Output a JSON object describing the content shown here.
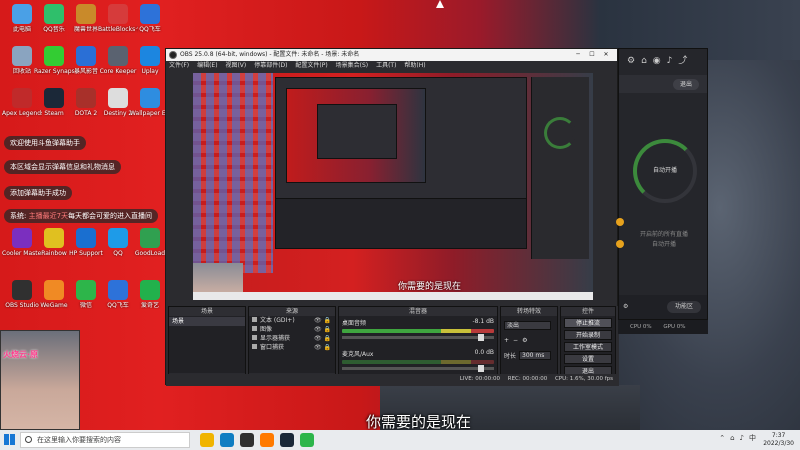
{
  "desktop_icons": [
    {
      "label": "此电脑",
      "color": "#4aa0e6"
    },
    {
      "label": "QQ音乐",
      "color": "#2fbf6b"
    },
    {
      "label": "魔兽世界",
      "color": "#c98a2a"
    },
    {
      "label": "BattleBlocks·快捷方式",
      "color": "#d63b3b"
    },
    {
      "label": "QQ飞车",
      "color": "#2d72d9"
    },
    {
      "label": "回收站",
      "color": "#8aa4c0"
    },
    {
      "label": "Razer Synapse",
      "color": "#33cc33"
    },
    {
      "label": "暴风影音",
      "color": "#2a6fd6"
    },
    {
      "label": "Core Keeper",
      "color": "#5a6270"
    },
    {
      "label": "Uplay",
      "color": "#1c86e0"
    },
    {
      "label": "Apex Legends",
      "color": "#c02a2a"
    },
    {
      "label": "Steam",
      "color": "#1b2838"
    },
    {
      "label": "DOTA 2",
      "color": "#a8302a"
    },
    {
      "label": "Destiny 2",
      "color": "#dddddd"
    },
    {
      "label": "Wallpaper Engine",
      "color": "#2e8de0"
    },
    {
      "label": "Cooler Master",
      "color": "#7b2fbf"
    },
    {
      "label": "Rainbow",
      "color": "#e0c020"
    },
    {
      "label": "HP Support",
      "color": "#1a6fd0"
    },
    {
      "label": "QQ",
      "color": "#1e9be8"
    },
    {
      "label": "GoodLoad",
      "color": "#30a050"
    },
    {
      "label": "OBS Studio",
      "color": "#303030"
    },
    {
      "label": "WeGame",
      "color": "#f08a24"
    },
    {
      "label": "微信",
      "color": "#2db54a"
    },
    {
      "label": "QQ飞车",
      "color": "#2d72d9"
    },
    {
      "label": "爱奇艺",
      "color": "#22b14c"
    }
  ],
  "chat_messages": [
    {
      "text": "欢迎使用斗鱼弹幕助手"
    },
    {
      "text": "本区域会显示弹幕信息和礼物消息"
    },
    {
      "text": "添加弹幕助手成功"
    },
    {
      "prefix": "系统: ",
      "highlight": "主播最近7天",
      "suffix": "每天都会可爱的进入直播间"
    }
  ],
  "webcam": {
    "caption": "火烧云·原"
  },
  "obs": {
    "title": "OBS 25.0.8 (64-bit, windows) - 配置文件: 未命名 - 场景: 未命名",
    "menu": [
      "文件(F)",
      "编辑(E)",
      "视图(V)",
      "停靠部件(D)",
      "配置文件(P)",
      "场景集合(S)",
      "工具(T)",
      "帮助(H)"
    ],
    "preview_subtitle": "你需要的是现在",
    "docks": {
      "scenes_title": "场景",
      "scenes": [
        "场景"
      ],
      "sources_title": "来源",
      "sources": [
        "文本 (GDI+)",
        "图像",
        "显示器捕获",
        "窗口捕获"
      ],
      "mixer_title": "混音器",
      "mixer": [
        {
          "name": "桌面音频",
          "db": "-8.1 dB"
        },
        {
          "name": "麦克风/Aux",
          "db": "0.0 dB"
        }
      ],
      "transition_title": "转场特效",
      "transition_type": "淡出",
      "duration_label": "时长",
      "duration_value": "300 ms",
      "controls_title": "控件",
      "controls": [
        "停止推流",
        "开始录制",
        "工作室模式",
        "设置",
        "退出"
      ]
    },
    "status": {
      "live": "LIVE: 00:00:00",
      "rec": "REC: 00:00:00",
      "cpu": "CPU: 1.6%, 30.00 fps"
    }
  },
  "side_panel": {
    "button": "退出",
    "ring_label": "自动开播",
    "info_text": "开启前的所有直播",
    "info_text2": "自动开播",
    "settings_label": "⚙",
    "premium_label": "功能区",
    "stats": [
      "CPU 0%",
      "GPU 0%"
    ]
  },
  "stream_subtitle": "你需要的是现在",
  "taskbar": {
    "search_placeholder": "在这里输入你要搜索的内容",
    "apps": [
      {
        "name": "file-explorer",
        "color": "#f0b400"
      },
      {
        "name": "edge",
        "color": "#0f7dc2"
      },
      {
        "name": "obs",
        "color": "#303030"
      },
      {
        "name": "douyu",
        "color": "#ff7a00"
      },
      {
        "name": "steam",
        "color": "#1b2838"
      },
      {
        "name": "wechat",
        "color": "#2db54a"
      }
    ],
    "time": "7:37",
    "date": "2022/3/30"
  }
}
